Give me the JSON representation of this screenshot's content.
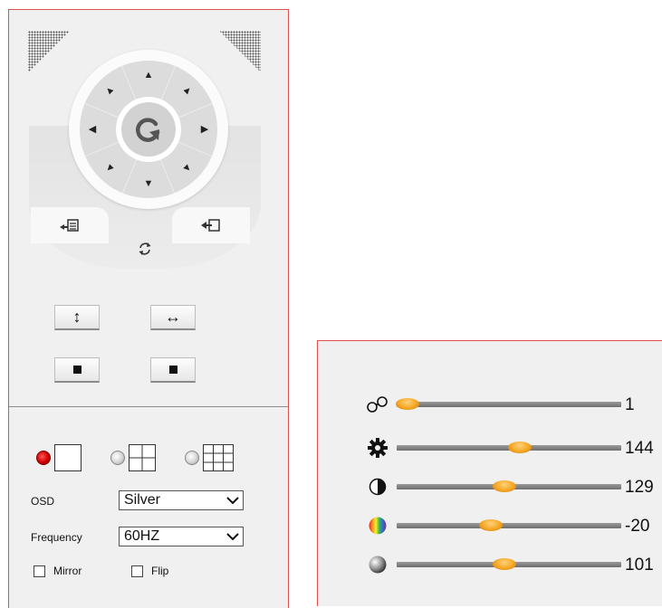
{
  "ptz": {
    "zoom_buttons": {
      "vertical_glyph": "↕",
      "horizontal_glyph": "↔"
    }
  },
  "layouts": [
    {
      "divisions": 1,
      "selected": true
    },
    {
      "divisions": 2,
      "selected": false
    },
    {
      "divisions": 3,
      "selected": false
    }
  ],
  "osd": {
    "label": "OSD",
    "value": "Silver"
  },
  "frequency": {
    "label": "Frequency",
    "value": "60HZ"
  },
  "mirror": {
    "label": "Mirror",
    "checked": false
  },
  "flip": {
    "label": "Flip",
    "checked": false
  },
  "image_sliders": [
    {
      "icon": "sharpness-icon",
      "value": "1",
      "level": 0.02
    },
    {
      "icon": "saturation-icon",
      "value": "144",
      "level": 0.55
    },
    {
      "icon": "contrast-icon",
      "value": "129",
      "level": 0.48
    },
    {
      "icon": "hue-icon",
      "value": "-20",
      "level": 0.42
    },
    {
      "icon": "brightness-icon",
      "value": "101",
      "level": 0.48
    }
  ],
  "colors": {
    "accent_border": "#e05050",
    "thumb": "#f5a623",
    "radio_selected": "#d00000"
  }
}
